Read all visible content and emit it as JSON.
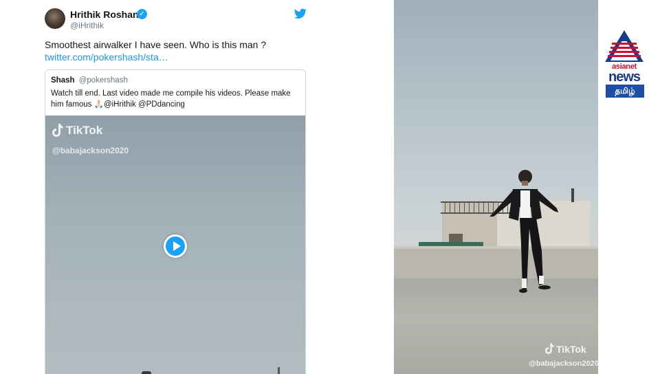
{
  "tweet": {
    "display_name": "Hrithik Roshan",
    "handle": "@iHrithik",
    "text": "Smoothest airwalker I have seen. Who is this man ?",
    "link_text": "twitter.com/pokershash/sta…",
    "quote": {
      "name": "Shash",
      "handle": "@pokershash",
      "text": "Watch till end. Last video made me compile his videos. Please make him famous 🙏🏻@iHrithik @PDdancing"
    },
    "video": {
      "brand": "TikTok",
      "username": "@babajackson2020"
    }
  },
  "side_video": {
    "brand": "TikTok",
    "username": "@babajackson2020"
  },
  "logo": {
    "word1": "asianet",
    "word2": "news",
    "tag": "தமிழ்"
  },
  "colors": {
    "twitter_blue": "#1da1f2",
    "link_blue": "#1b95e0",
    "brand_red": "#c8102e",
    "brand_navy": "#1b3a86"
  }
}
